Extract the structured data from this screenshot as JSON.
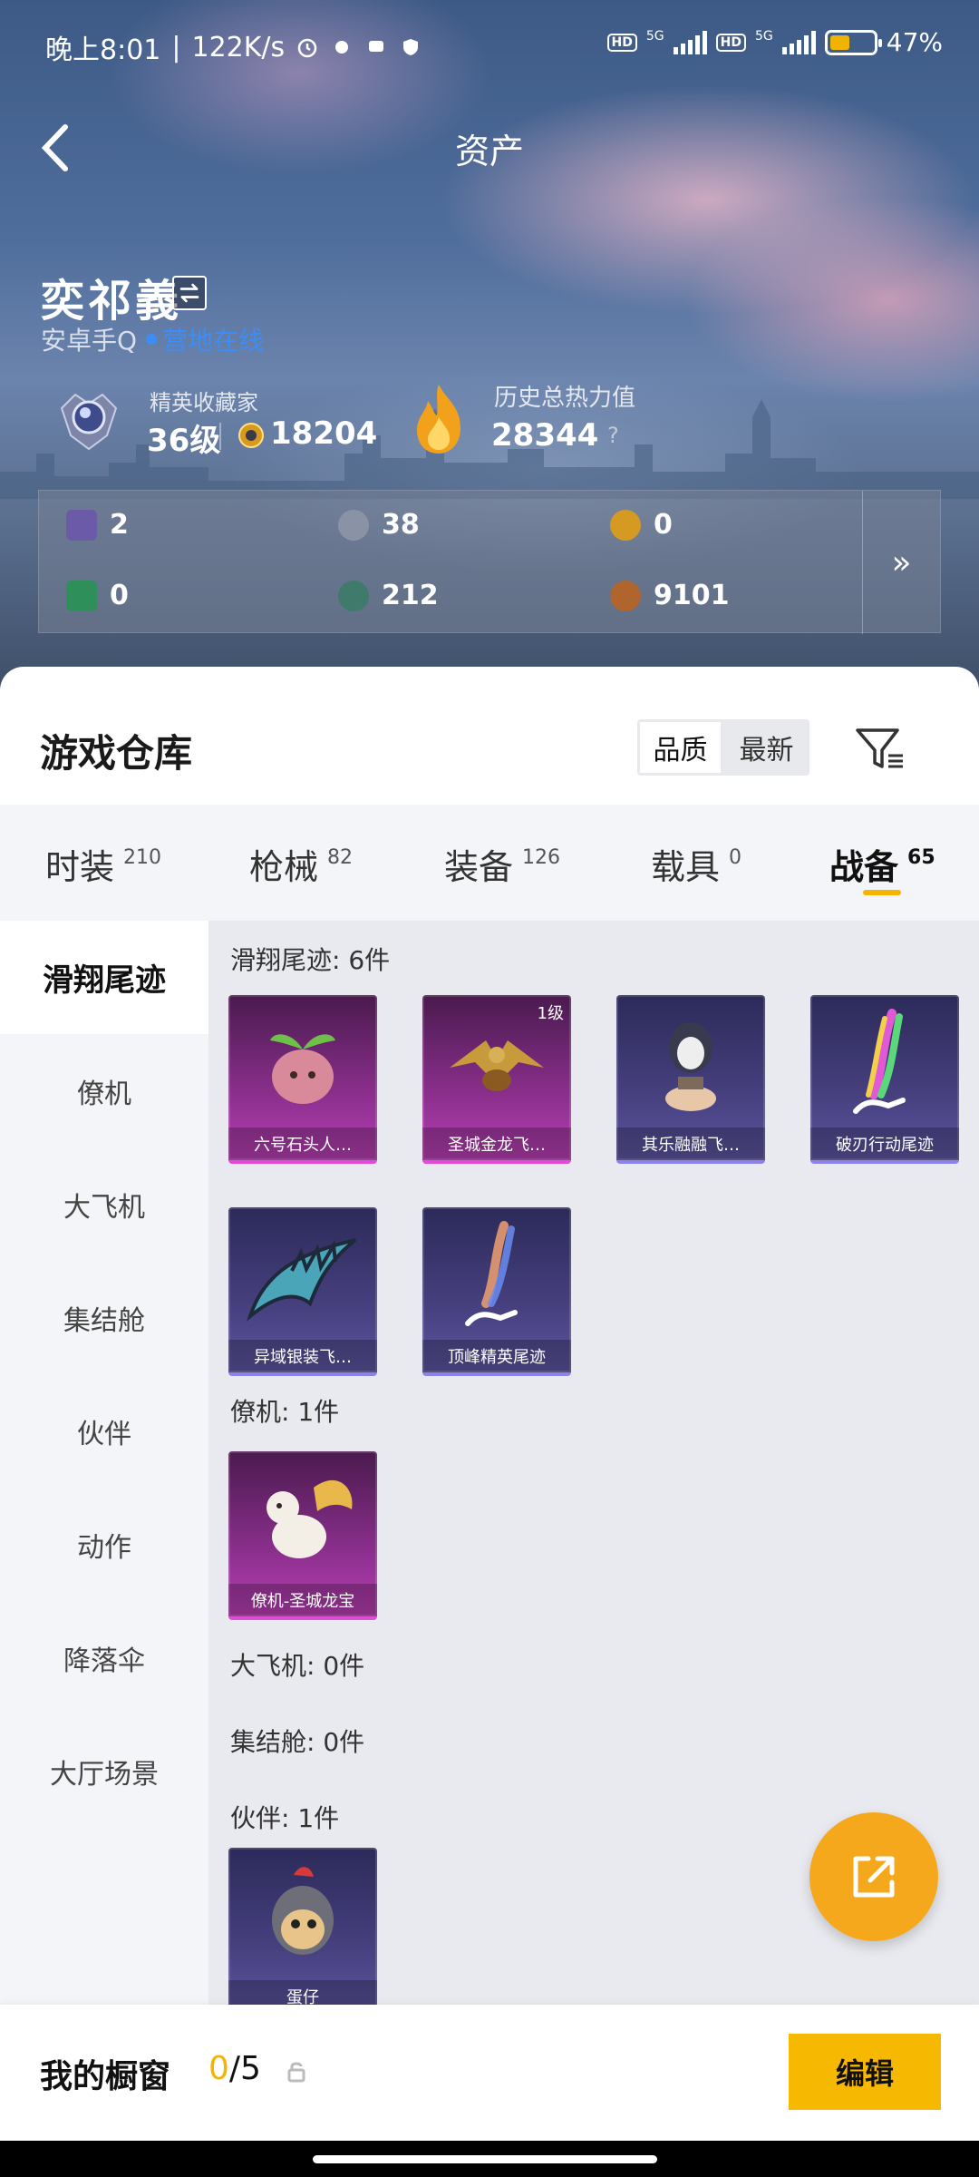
{
  "status_bar": {
    "time": "晚上8:01",
    "speed": "122K/s",
    "signal1": "5G",
    "signal2": "5G",
    "hd": "HD",
    "battery": "47%",
    "battery_level": 0.47
  },
  "header": {
    "title": "资产"
  },
  "profile": {
    "name": "奕祁義",
    "platform": "安卓手Q",
    "online_status": "营地在线",
    "rank_title": "精英收藏家",
    "rank_level": "36级",
    "coins": "18204",
    "heat_title": "历史总热力值",
    "heat_value": "28344",
    "help": "?"
  },
  "resources": [
    {
      "icon": "purple-card-icon",
      "value": "2",
      "color": "#6a5aa8"
    },
    {
      "icon": "silver-token-icon",
      "value": "38",
      "color": "#8a93a6"
    },
    {
      "icon": "gold-token-icon",
      "value": "0",
      "color": "#d49a22"
    },
    {
      "icon": "green-card-icon",
      "value": "0",
      "color": "#2f8f5a"
    },
    {
      "icon": "green-orb-icon",
      "value": "212",
      "color": "#3f7a6a"
    },
    {
      "icon": "bronze-orb-icon",
      "value": "9101",
      "color": "#b0652e"
    }
  ],
  "resources_more": "»",
  "warehouse": {
    "title": "游戏仓库",
    "sort_options": [
      "品质",
      "最新"
    ],
    "active_sort": 0
  },
  "tabs": [
    {
      "label": "时装",
      "count": "210"
    },
    {
      "label": "枪械",
      "count": "82"
    },
    {
      "label": "装备",
      "count": "126"
    },
    {
      "label": "载具",
      "count": "0"
    },
    {
      "label": "战备",
      "count": "65"
    }
  ],
  "active_tab": 4,
  "side_nav": [
    "滑翔尾迹",
    "僚机",
    "大飞机",
    "集结舱",
    "伙伴",
    "动作",
    "降落伞",
    "大厅场景"
  ],
  "sections": {
    "glide": {
      "title": "滑翔尾迹: 6件",
      "items": [
        {
          "name": "六号石头人…",
          "rarity": "purple"
        },
        {
          "name": "圣城金龙飞…",
          "rarity": "purple",
          "level": "1级"
        },
        {
          "name": "其乐融融飞…",
          "rarity": "blue"
        },
        {
          "name": "破刃行动尾迹",
          "rarity": "blue"
        },
        {
          "name": "异域银装飞…",
          "rarity": "blue"
        },
        {
          "name": "顶峰精英尾迹",
          "rarity": "blue"
        }
      ]
    },
    "wingman": {
      "title": "僚机: 1件",
      "items": [
        {
          "name": "僚机-圣城龙宝",
          "rarity": "purple"
        }
      ]
    },
    "plane": {
      "title": "大飞机: 0件"
    },
    "pod": {
      "title": "集结舱: 0件"
    },
    "partner": {
      "title": "伙伴: 1件",
      "items": [
        {
          "name": "蛋仔",
          "rarity": "blue"
        }
      ]
    }
  },
  "bottom_bar": {
    "label": "我的橱窗",
    "used": "0",
    "total": "/5",
    "edit": "编辑"
  }
}
